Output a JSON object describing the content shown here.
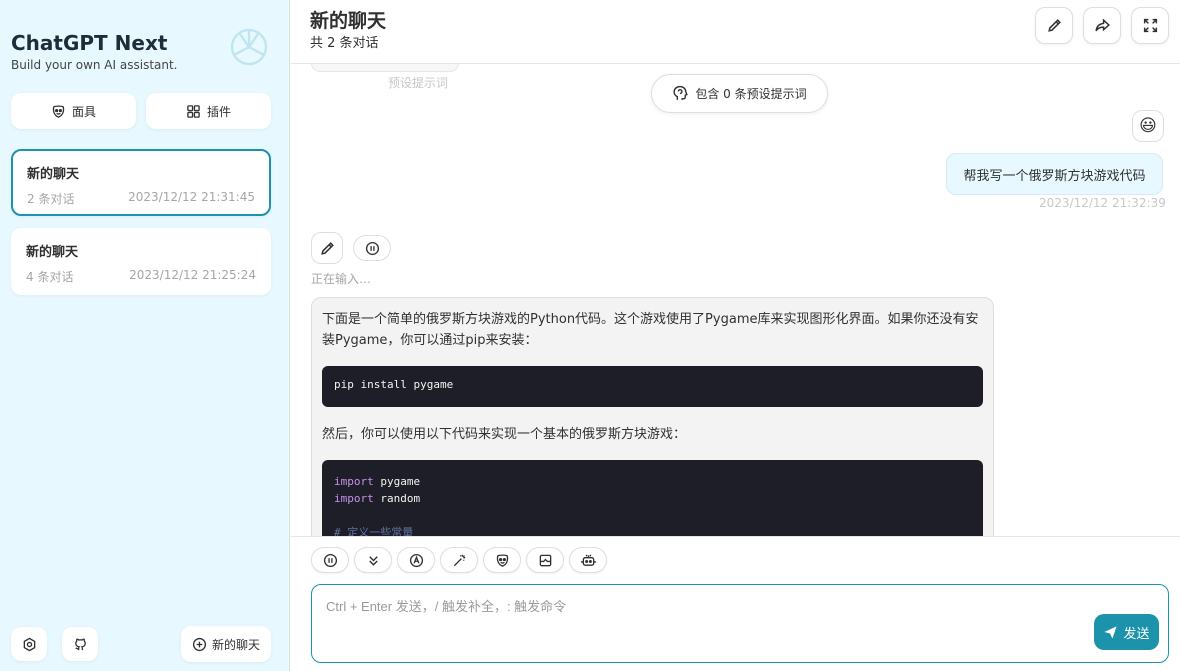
{
  "sidebar": {
    "title": "ChatGPT Next",
    "subtitle": "Build your own AI assistant.",
    "mask_label": "面具",
    "plugin_label": "插件",
    "chats": [
      {
        "title": "新的聊天",
        "count": "2 条对话",
        "time": "2023/12/12 21:31:45",
        "selected": true
      },
      {
        "title": "新的聊天",
        "count": "4 条对话",
        "time": "2023/12/12 21:25:24",
        "selected": false
      }
    ],
    "new_chat_label": "新的聊天"
  },
  "header": {
    "title": "新的聊天",
    "subtitle": "共 2 条对话"
  },
  "messages": {
    "ghost_label": "预设提示词",
    "prompt_hint": "包含 0 条预设提示词",
    "user_avatar": "😃",
    "user_text": "帮我写一个俄罗斯方块游戏代码",
    "user_time": "2023/12/12 21:32:39",
    "typing": "正在输入…",
    "bot_p1": "下面是一个简单的俄罗斯方块游戏的Python代码。这个游戏使用了Pygame库来实现图形化界面。如果你还没有安装Pygame，你可以通过pip来安装：",
    "code1": "pip install pygame",
    "bot_p2": "然后，你可以使用以下代码来实现一个基本的俄罗斯方块游戏：",
    "code2_kw1": "import",
    "code2_mod1": " pygame",
    "code2_kw2": "import",
    "code2_mod2": " random",
    "code2_comment": "# 定义一些常量"
  },
  "input": {
    "placeholder": "Ctrl + Enter 发送，/ 触发补全，: 触发命令",
    "send_label": "发送"
  },
  "colors": {
    "accent": "#1d93ab",
    "sidebar_bg": "#e7f8ff",
    "code_bg": "#1d1e27"
  }
}
